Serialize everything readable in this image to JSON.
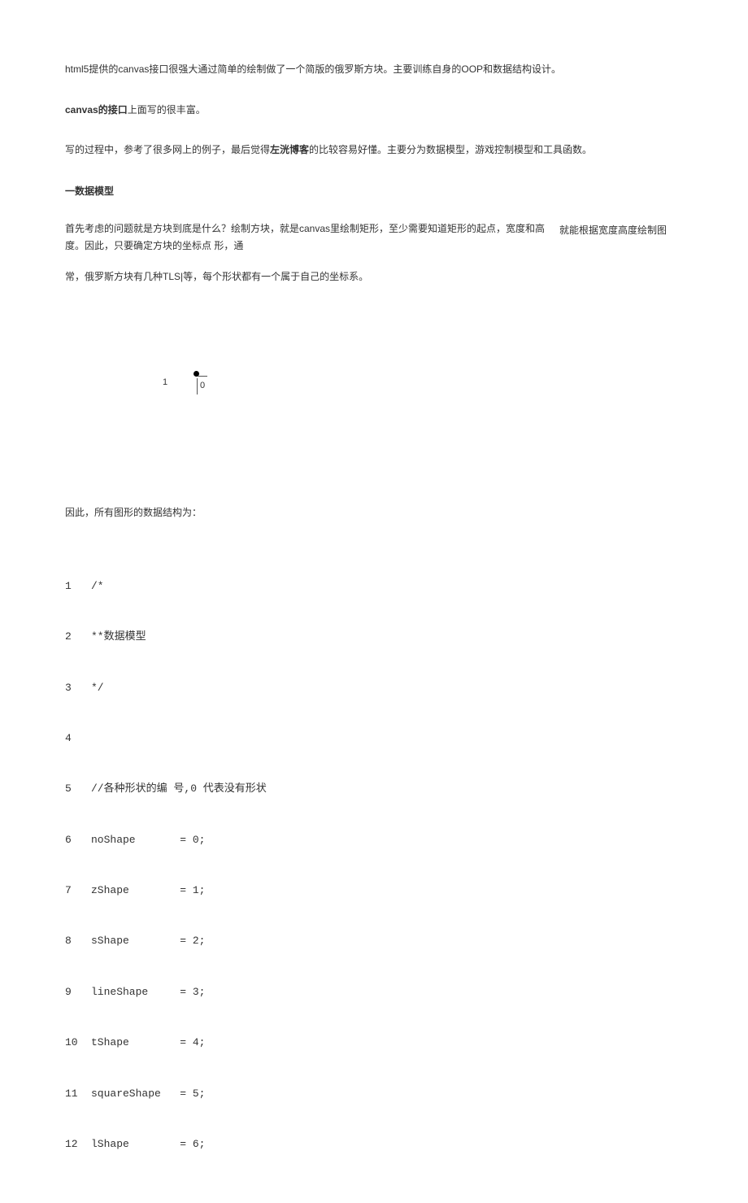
{
  "intro": {
    "p1": "html5提供的canvas接口很强大通过简单的绘制做了一个简版的俄罗斯方块。主要训练自身的OOP和数据结构设计。",
    "p2_prefix": "canvas的接口",
    "p2_rest": "上面写的很丰富。",
    "p3_a": "写的过程中，参考了很多网上的例子，最后觉得",
    "p3_bold": "左洸博客",
    "p3_b": "的比较容易好懂。主要分为数据模型，游戏控制模型和工具函数。"
  },
  "section1": {
    "heading": "一数据模型",
    "body_a": "首先考虑的问题就是方块到底是什么？绘制方块，就是canvas里绘制矩形，至少需要知道矩形的起点，宽度和高度。因此，只要确定方块的坐标点 形，通",
    "side": "就能根据宽度高度绘制图",
    "body_b": "常，俄罗斯方块有几种TLS|等，每个形状都有一个属于自己的坐标系。"
  },
  "figure": {
    "left_label": "1",
    "zero_label": "0"
  },
  "afterfig": "因此，所有图形的数据结构为：",
  "code": {
    "lines": [
      {
        "n": "1",
        "c": "/*"
      },
      {
        "n": "2",
        "c": "**数据模型"
      },
      {
        "n": "3",
        "c": "*/"
      },
      {
        "n": "4",
        "c": ""
      },
      {
        "n": "5",
        "c": "//各种形状的编 号,0 代表没有形状"
      },
      {
        "n": "6",
        "c": "noShape       = 0;"
      },
      {
        "n": "7",
        "c": "zShape        = 1;"
      },
      {
        "n": "8",
        "c": "sShape        = 2;"
      },
      {
        "n": "9",
        "c": "lineShape     = 3;"
      },
      {
        "n": "10",
        "c": "tShape        = 4;"
      },
      {
        "n": "11",
        "c": "squareShape   = 5;"
      },
      {
        "n": "12",
        "c": "lShape        = 6;"
      }
    ]
  }
}
